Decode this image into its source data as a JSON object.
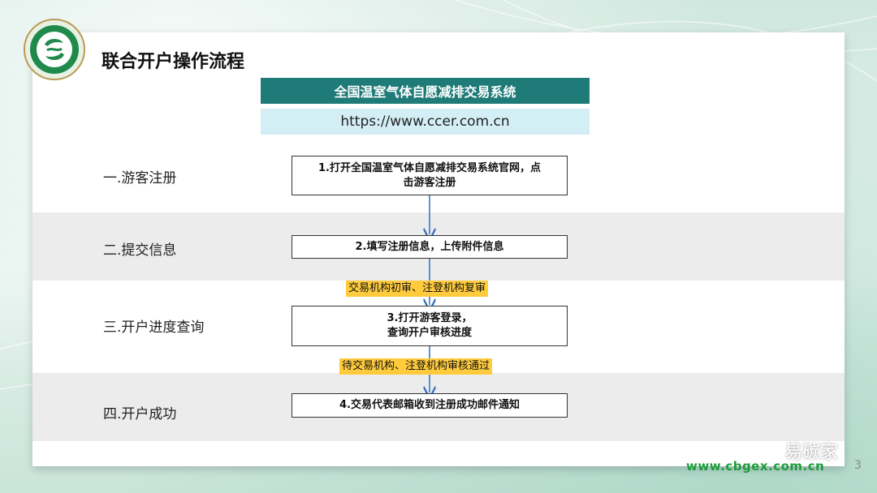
{
  "title": "联合开户操作流程",
  "system": {
    "name": "全国温室气体自愿减排交易系统",
    "url": "https://www.ccer.com.cn"
  },
  "stages": [
    {
      "label": "一.游客注册",
      "step_line1": "1.打开全国温室气体自愿减排交易系统官网，点",
      "step_line2": "击游客注册"
    },
    {
      "label": "二.提交信息",
      "step_line1": "2.填写注册信息，上传附件信息",
      "step_line2": ""
    },
    {
      "label": "三.开户进度查询",
      "step_line1": "3.打开游客登录，",
      "step_line2": "查询开户审核进度"
    },
    {
      "label": "四.开户成功",
      "step_line1": "4.交易代表邮箱收到注册成功邮件通知",
      "step_line2": ""
    }
  ],
  "notes": {
    "review_first": "交易机构初审、注登机构复审",
    "review_pass": "待交易机构、注登机构审核通过"
  },
  "footer": {
    "url": "www.cbgex.com.cn",
    "page": "3",
    "wechat_name": "易碳家"
  },
  "colors": {
    "header_bar": "#1f7b78",
    "url_bar": "#d3eff5",
    "note_highlight": "#ffcb3d",
    "arrow": "#2f6fbf",
    "footer_url": "#1e9b3a",
    "logo_green": "#1f8a4c"
  },
  "icons": {
    "logo": "organization-seal-icon",
    "wechat": "wechat-icon"
  }
}
